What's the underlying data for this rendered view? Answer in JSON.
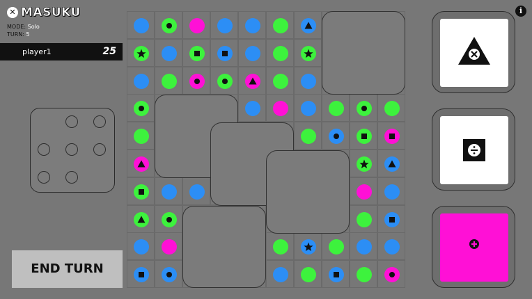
{
  "header": {
    "logo_glyph": "✕",
    "title": "MASUKU",
    "mode_label": "MODE:",
    "mode_value": "Solo",
    "turn_label": "TURN:",
    "turn_value": "5"
  },
  "player": {
    "name": "player1",
    "score": "25"
  },
  "actions": {
    "end_turn_label": "END TURN"
  },
  "info_glyph": "i",
  "colors": {
    "blue": "#2c8ef5",
    "green": "#3df23d",
    "magenta": "#ff10d6",
    "background": "#777777",
    "board_line": "#6a6a6a",
    "symbol": "#111111"
  },
  "cards": [
    {
      "symbol": "triangle-x-icon",
      "fill": "#ffffff"
    },
    {
      "symbol": "square-divide-icon",
      "fill": "#ffffff"
    },
    {
      "symbol": "circle-plus-icon",
      "fill": "#ff10d6"
    }
  ],
  "board": {
    "rows": [
      [
        "B:",
        "G:c",
        "M:",
        "B:",
        "B:",
        "G:",
        "B:t",
        "E:",
        "M:",
        "G:c"
      ],
      [
        "G:s",
        "B:",
        "G:q",
        "B:q",
        "B:",
        "G:",
        "G:s",
        "M:c",
        "M:t",
        "E:"
      ],
      [
        "B:",
        "G:",
        "M:c",
        "G:c",
        "M:t",
        "G:",
        "B:",
        "E:",
        "B:t",
        "E:"
      ],
      [
        "G:c",
        "E:",
        "B:",
        "E:",
        "B:",
        "M:",
        "B:",
        "G:",
        "G:c",
        "G:"
      ],
      [
        "G:",
        "G:",
        "M:t",
        "E:",
        "M:s",
        "M:q",
        "G:",
        "B:c",
        "G:q",
        "M:q"
      ],
      [
        "M:t",
        "E:",
        "M:",
        "M:t",
        "E:",
        "E:",
        "B:q",
        "G:",
        "G:s",
        "B:t"
      ],
      [
        "G:q",
        "B:",
        "B:",
        "E:",
        "E:",
        "M:q",
        "B:",
        "G:",
        "M:",
        "B:"
      ],
      [
        "G:t",
        "G:c",
        "E:",
        "E:",
        "G:",
        "M:t",
        "E:",
        "M:t",
        "G:",
        "B:q"
      ],
      [
        "B:",
        "M:",
        "E:",
        "E:",
        "M:",
        "G:",
        "B:s",
        "G:",
        "B:",
        "B:"
      ],
      [
        "B:q",
        "B:c",
        "B:t",
        "M:t",
        "E:",
        "B:",
        "G:",
        "B:q",
        "G:",
        "M:c"
      ]
    ]
  }
}
